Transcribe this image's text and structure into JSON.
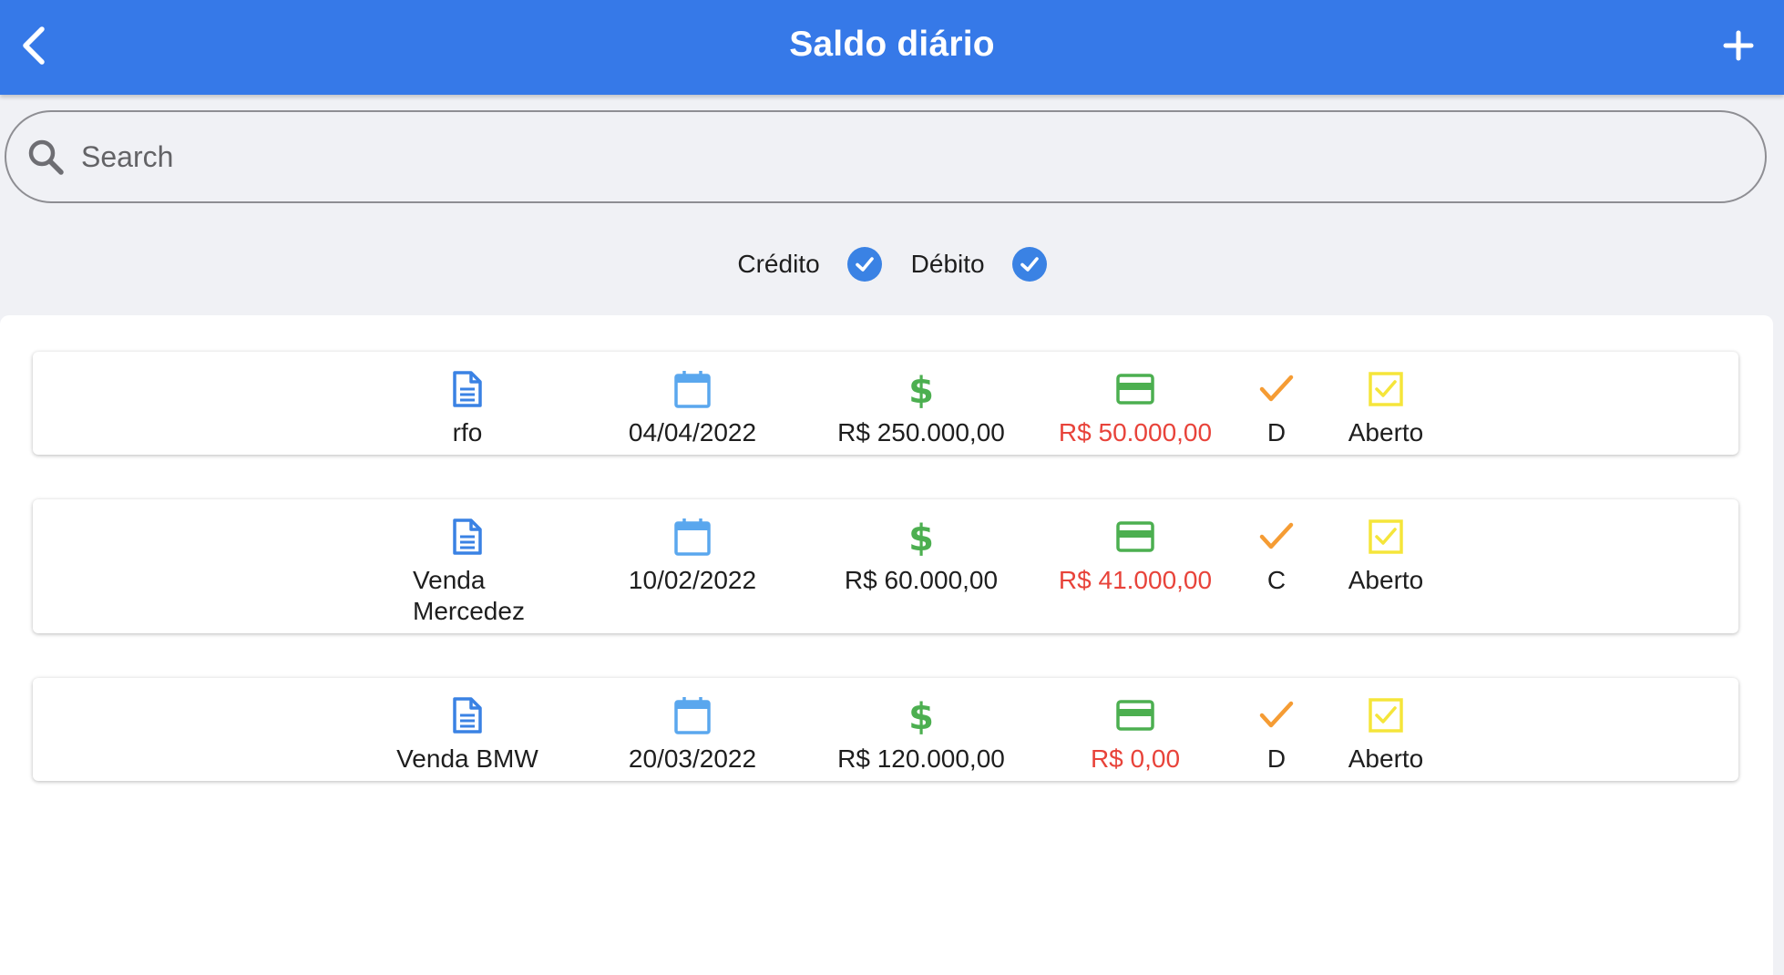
{
  "header": {
    "title": "Saldo diário",
    "back_icon": "chevron-left-icon",
    "add_icon": "plus-icon"
  },
  "search": {
    "placeholder": "Search",
    "value": "",
    "icon": "search-icon"
  },
  "filters": [
    {
      "label": "Crédito",
      "checked": true
    },
    {
      "label": "Débito",
      "checked": true
    }
  ],
  "colors": {
    "header_bg": "#3679e8",
    "document_icon": "#3a82e4",
    "calendar_icon": "#5aa7ee",
    "dollar_icon": "#4caf50",
    "card_icon": "#4caf50",
    "check_icon": "#f59c34",
    "status_icon": "#f5e53a",
    "negative_value": "#e8433a"
  },
  "icons": {
    "description": "document-icon",
    "date": "calendar-icon",
    "value": "dollar-icon",
    "balance": "credit-card-icon",
    "type": "checkmark-icon",
    "status": "checkbox-icon"
  },
  "entries": [
    {
      "description": "rfo",
      "date": "04/04/2022",
      "value": "R$ 250.000,00",
      "balance": "R$ 50.000,00",
      "type": "D",
      "status": "Aberto"
    },
    {
      "description": "Venda Mercedez",
      "date": "10/02/2022",
      "value": "R$ 60.000,00",
      "balance": "R$ 41.000,00",
      "type": "C",
      "status": "Aberto"
    },
    {
      "description": "Venda BMW",
      "date": "20/03/2022",
      "value": "R$ 120.000,00",
      "balance": "R$ 0,00",
      "type": "D",
      "status": "Aberto"
    }
  ]
}
